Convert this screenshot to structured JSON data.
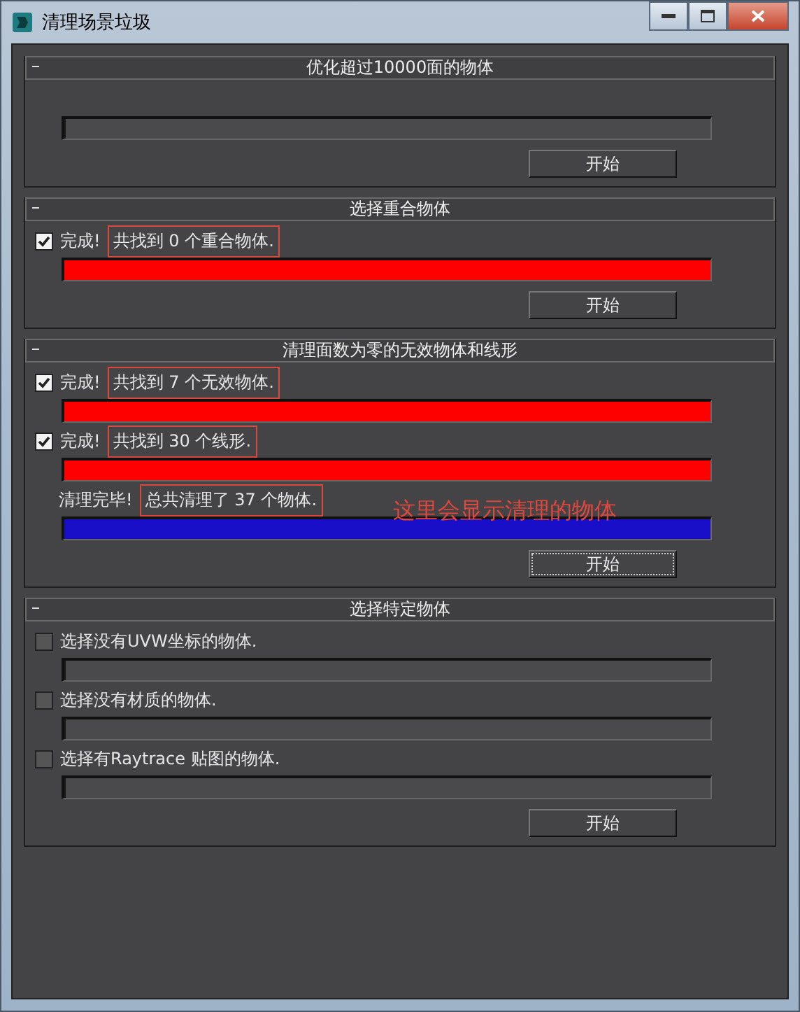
{
  "window": {
    "title": "清理场景垃圾"
  },
  "sections": [
    {
      "title": "优化超过10000面的物体",
      "items": [
        {
          "kind": "spacer"
        },
        {
          "kind": "bar",
          "level": 0
        }
      ],
      "button": "开始",
      "button_focused": false
    },
    {
      "title": "选择重合物体",
      "items": [
        {
          "kind": "check",
          "checked": true,
          "label": "完成!",
          "message": "共找到 0 个重合物体.",
          "highlighted": true
        },
        {
          "kind": "bar",
          "level": 1,
          "color": "#ff0000"
        }
      ],
      "button": "开始",
      "button_focused": false
    },
    {
      "title": "清理面数为零的无效物体和线形",
      "items": [
        {
          "kind": "check",
          "checked": true,
          "label": "完成!",
          "message": "共找到 7 个无效物体.",
          "highlighted": true
        },
        {
          "kind": "bar",
          "level": 1,
          "color": "#ff0000"
        },
        {
          "kind": "check",
          "checked": true,
          "label": "完成!",
          "message": "共找到 30 个线形.",
          "highlighted": true
        },
        {
          "kind": "bar",
          "level": 1,
          "color": "#ff0000"
        },
        {
          "kind": "note",
          "label": "清理完毕!",
          "message": "总共清理了 37 个物体.",
          "highlighted": true,
          "annotation": "这里会显示清理的物体"
        },
        {
          "kind": "bar",
          "level": 1,
          "color": "#1a0fc8"
        }
      ],
      "button": "开始",
      "button_focused": true
    },
    {
      "title": "选择特定物体",
      "items": [
        {
          "kind": "check",
          "checked": false,
          "label": "选择没有UVW坐标的物体."
        },
        {
          "kind": "bar",
          "level": 0
        },
        {
          "kind": "check",
          "checked": false,
          "label": "选择没有材质的物体."
        },
        {
          "kind": "bar",
          "level": 0
        },
        {
          "kind": "check",
          "checked": false,
          "label": "选择有Raytrace 贴图的物体."
        },
        {
          "kind": "bar",
          "level": 0
        }
      ],
      "button": "开始",
      "button_focused": false
    }
  ]
}
